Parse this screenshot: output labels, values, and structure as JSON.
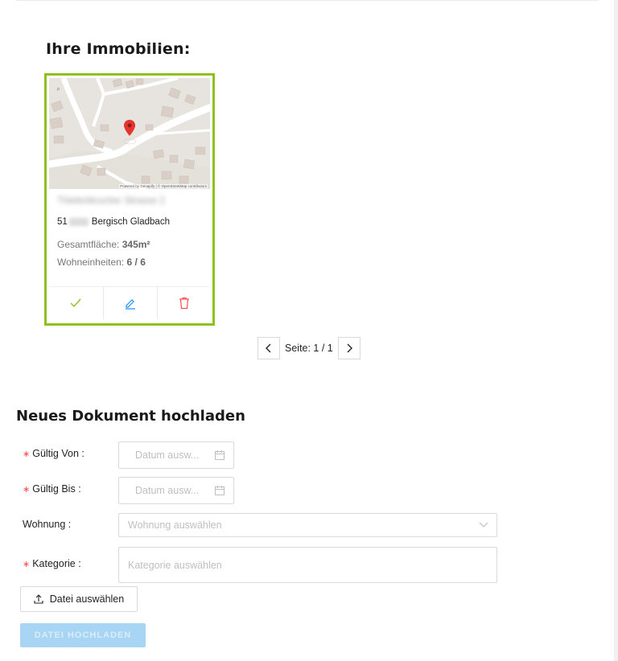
{
  "properties": {
    "title": "Ihre Immobilien:",
    "card": {
      "street_blurred": "Thielenbrucher Strasse 2",
      "zip_prefix": "51",
      "city": "Bergisch Gladbach",
      "area_label": "Gesamtfläche:",
      "area_value": "345m²",
      "units_label": "Wohneinheiten:",
      "units_value": "6 / 6",
      "map_attribution": "Powered by Geoapify | © OpenStreetMap contributors"
    },
    "actions": {
      "select_icon": "check-icon",
      "edit_icon": "pencil-icon",
      "delete_icon": "trash-icon"
    },
    "pager": {
      "label": "Seite: 1 / 1"
    }
  },
  "upload": {
    "title": "Neues Dokument hochladen",
    "valid_from": {
      "label": "Gültig Von",
      "placeholder": "Datum ausw..."
    },
    "valid_to": {
      "label": "Gültig Bis",
      "placeholder": "Datum ausw..."
    },
    "apartment": {
      "label": "Wohnung",
      "placeholder": "Wohnung auswählen"
    },
    "category": {
      "label": "Kategorie",
      "placeholder": "Kategorie auswählen"
    },
    "file_button": "Datei auswählen",
    "submit_button": "DATEI HOCHLADEN"
  },
  "colors": {
    "card_border": "#8cc21c",
    "check": "#8cc21c",
    "edit": "#1890ff",
    "delete": "#ff4d4f",
    "required": "#ff4d4f",
    "submit_disabled": "#a9d5f5"
  }
}
